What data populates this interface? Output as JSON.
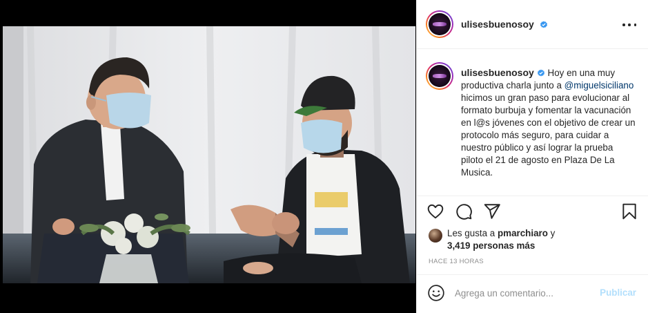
{
  "post": {
    "username": "ulisesbuenosoy",
    "verified": true,
    "caption": {
      "username": "ulisesbuenosoy",
      "text_before_mention": "Hoy en una muy productiva charla junto a",
      "mention": "@miguelsiciliano",
      "text_after_mention": "hicimos un gran paso para evolucionar al formato burbuja y fomentar la vacunación en l@s jóvenes con el objetivo de crear un protocolo más seguro, para cuidar a nuestro público y así lograr la prueba piloto el 21 de agosto en Plaza De La Musica."
    },
    "likes": {
      "prefix": "Les gusta a",
      "user": "pmarchiaro",
      "suffix": "y",
      "count_text": "3,419 personas más"
    },
    "timestamp": "HACE 13 HORAS",
    "comment": {
      "placeholder": "Agrega un comentario...",
      "publish_label": "Publicar"
    }
  },
  "icons": {
    "more": "more-options-icon",
    "like": "heart-icon",
    "comment": "comment-bubble-icon",
    "share": "paper-plane-icon",
    "save": "bookmark-icon",
    "emoji": "smiley-icon",
    "verified": "verified-badge-icon"
  },
  "colors": {
    "verified": "#3897f0",
    "mention": "#00376b",
    "publish_disabled": "#b2dffc",
    "muted": "#8e8e8e",
    "text": "#262626"
  }
}
